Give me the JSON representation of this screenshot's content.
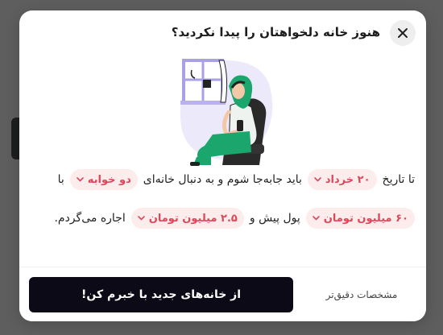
{
  "modal": {
    "title": "هنوز خانه دلخواهتان را پیدا نکردید؟",
    "close_icon": "close-icon"
  },
  "illustration": {
    "icon": "woman-with-phone-in-armchair-illustration"
  },
  "form": {
    "row1": {
      "text_until": "تا تاریخ",
      "date_value": "۲۰ خرداد",
      "text_move": "باید جابه‌جا شوم و به دنبال خانه‌ای",
      "rooms_value": "دو خوابه",
      "text_with": "با"
    },
    "row2": {
      "deposit_value": "۶۰ میلیون تومان",
      "text_deposit": "پول پیش و",
      "rent_value": "۲.۵ میلیون تومان",
      "text_rent": "اجاره می‌گردم."
    }
  },
  "footer": {
    "primary_label": "از خانه‌های جدید با خبرم کن!",
    "secondary_label": "مشخصات دقیق‌تر"
  },
  "colors": {
    "accent": "#e0465a",
    "chip_bg": "#fdecec",
    "primary_button": "#0d0a17"
  }
}
